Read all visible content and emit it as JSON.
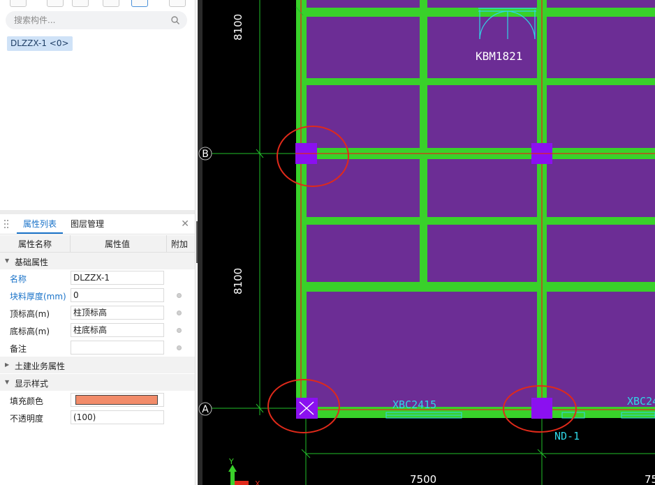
{
  "sidebar": {
    "search_placeholder": "搜索构件...",
    "selected_component": "DLZZX-1 <0>"
  },
  "panel": {
    "tabs": [
      "属性列表",
      "图层管理"
    ],
    "columns": [
      "属性名称",
      "属性值",
      "附加"
    ],
    "groups": {
      "basic": "基础属性",
      "civil": "土建业务属性",
      "display": "显示样式"
    },
    "properties": [
      {
        "label": "名称",
        "value": "DLZZX-1"
      },
      {
        "label": "块料厚度(mm)",
        "value": "0"
      },
      {
        "label": "顶标高(m)",
        "value": "柱顶标高"
      },
      {
        "label": "底标高(m)",
        "value": "柱底标高"
      },
      {
        "label": "备注",
        "value": ""
      }
    ],
    "display_props": [
      {
        "label": "填充颜色",
        "color": "#f28c6a"
      },
      {
        "label": "不透明度",
        "value": "(100)"
      }
    ]
  },
  "canvas": {
    "axis_B": "B",
    "axis_A": "A",
    "dim_top_left": "8100",
    "dim_mid_left": "8100",
    "dim_bottom": "7500",
    "dim_bottom_right": "75",
    "door_label": "KBM1821",
    "window_label_1": "XBC2415",
    "window_label_2": "XBC24",
    "nd_label": "ND-1",
    "ucs_y": "Y",
    "ucs_x": "X"
  },
  "colors": {
    "slab": "#6c2d95",
    "beam": "#39d12a",
    "column": "#8b10f0",
    "highlight_circle": "#e02a1a",
    "cad_cyan": "#2fd6e6"
  }
}
